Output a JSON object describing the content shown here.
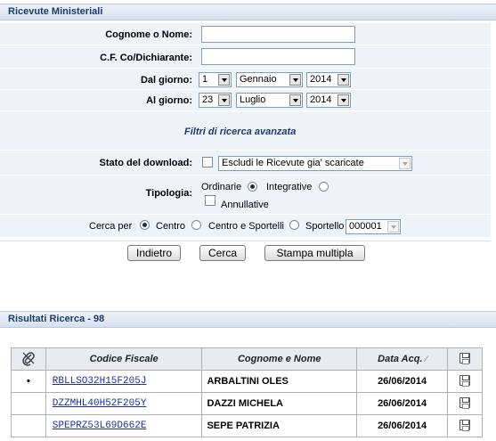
{
  "section_title": "Ricevute Ministeriali",
  "form": {
    "cognome_label": "Cognome o Nome:",
    "cognome_value": "",
    "cf_label": "C.F. Co/Dichiarante:",
    "cf_value": "",
    "dal_label": "Dal giorno:",
    "dal_day": "1",
    "dal_month": "Gennaio",
    "dal_year": "2014",
    "al_label": "Al giorno:",
    "al_day": "23",
    "al_month": "Luglio",
    "al_year": "2014",
    "advanced_label": "Filtri di ricerca avanzata",
    "stato_label": "Stato del download:",
    "stato_value": "Escludi le Ricevute gia' scaricate",
    "tipologia_label": "Tipologia:",
    "ordinarie": "Ordinarie",
    "integrative": "Integrative",
    "annullative": "Annullative",
    "cerca_per": "Cerca per",
    "centro": "Centro",
    "centro_sportelli": "Centro e Sportelli",
    "sportello": "Sportello",
    "sportello_value": "000001"
  },
  "buttons": {
    "indietro": "Indietro",
    "cerca": "Cerca",
    "stampa": "Stampa multipla"
  },
  "results": {
    "title": "Risultati Ricerca - ",
    "count": "98"
  },
  "table": {
    "headers": {
      "cf": "Codice Fiscale",
      "nome": "Cognome e Nome",
      "data": "Data Acq."
    },
    "rows": [
      {
        "bullet": "•",
        "cf": "RBLLSO32H15F205J",
        "nome": "ARBALTINI OLES",
        "data": "26/06/2014"
      },
      {
        "bullet": "",
        "cf": "DZZMHL40H52F205Y",
        "nome": "DAZZI MICHELA",
        "data": "26/06/2014"
      },
      {
        "bullet": "",
        "cf": "SPEPRZ53L69D662E",
        "nome": "SEPE PATRIZIA",
        "data": "26/06/2014"
      }
    ]
  },
  "icons": {
    "clip": "paperclip-icon",
    "save": "floppy-disk-icon",
    "sort": "sort-icon"
  }
}
